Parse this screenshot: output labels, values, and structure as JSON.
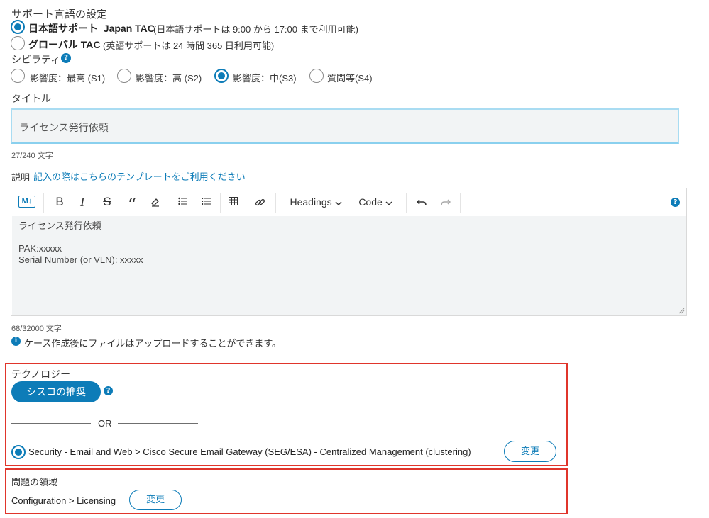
{
  "support_language": {
    "heading": "サポート言語の設定",
    "options": [
      {
        "label": "日本語サポート  Japan TAC",
        "note": "(日本語サポートは 9:00 から 17:00 まで利用可能)",
        "selected": true
      },
      {
        "label": "グローバル TAC",
        "note": "(英語サポートは 24 時間 365 日利用可能)",
        "selected": false
      }
    ]
  },
  "severity": {
    "heading": "シビラティ",
    "help_glyph": "?",
    "options": [
      {
        "label": "影響度：最高 (S1)",
        "selected": false
      },
      {
        "label": "影響度：高 (S2)",
        "selected": false
      },
      {
        "label": "影響度：中(S3)",
        "selected": true
      },
      {
        "label": "質問等(S4)",
        "selected": false
      }
    ]
  },
  "title_field": {
    "label": "タイトル",
    "value": "ライセンス発行依頼",
    "counter": "27/240 文字"
  },
  "description": {
    "label": "説明",
    "template_link": "記入の際はこちらのテンプレートをご利用ください",
    "toolbar": {
      "markdown_glyph": "M↓",
      "bold": "B",
      "italic": "I",
      "strike": "S",
      "quote": "“",
      "headings_label": "Headings",
      "code_label": "Code",
      "help_glyph": "?"
    },
    "body_lines": [
      "ライセンス発行依頼",
      "",
      "PAK:xxxxx",
      "Serial Number (or VLN): xxxxx"
    ],
    "counter": "68/32000 文字",
    "upload_note": "ケース作成後にファイルはアップロードすることができます。",
    "info_glyph": "i"
  },
  "technology": {
    "heading": "テクノロジー",
    "recommend_button": "シスコの推奨",
    "help_glyph": "?",
    "or_label": "OR",
    "selected_path": "Security - Email and Web > Cisco Secure Email Gateway (SEG/ESA) - Centralized Management (clustering)",
    "change_button": "変更"
  },
  "problem_area": {
    "heading": "問題の領域",
    "value": "Configuration > Licensing",
    "change_button": "変更"
  },
  "colors": {
    "accent": "#0d7cb8",
    "highlight_border": "#e0352b"
  }
}
